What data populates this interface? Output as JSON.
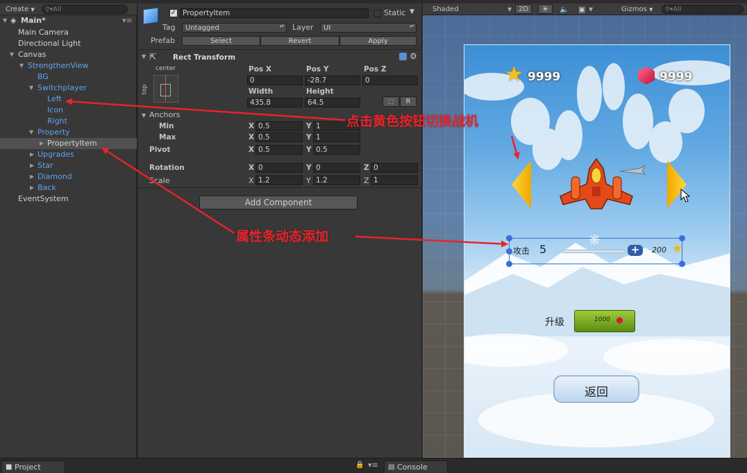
{
  "hierarchy": {
    "create_label": "Create",
    "search_placeholder": "All",
    "scene_name": "Main*",
    "items": [
      {
        "label": "Main Camera"
      },
      {
        "label": "Directional Light"
      },
      {
        "label": "Canvas"
      },
      {
        "label": "StrengthenView"
      },
      {
        "label": "BG"
      },
      {
        "label": "Switchplayer"
      },
      {
        "label": "Left"
      },
      {
        "label": "Icon"
      },
      {
        "label": "Right"
      },
      {
        "label": "Property"
      },
      {
        "label": "PropertyItem"
      },
      {
        "label": "Upgrades"
      },
      {
        "label": "Star"
      },
      {
        "label": "Diamond"
      },
      {
        "label": "Back"
      },
      {
        "label": "EventSystem"
      }
    ]
  },
  "inspector": {
    "object_name": "PropertyItem",
    "static_label": "Static",
    "tag_label": "Tag",
    "tag_value": "Untagged",
    "layer_label": "Layer",
    "layer_value": "UI",
    "prefab_label": "Prefab",
    "prefab_select": "Select",
    "prefab_revert": "Revert",
    "prefab_apply": "Apply",
    "rect_transform_title": "Rect Transform",
    "anchor_preset_h": "center",
    "anchor_preset_v": "top",
    "pos_x_label": "Pos X",
    "pos_y_label": "Pos Y",
    "pos_z_label": "Pos Z",
    "pos_x": "0",
    "pos_y": "-28.7",
    "pos_z": "0",
    "width_label": "Width",
    "height_label": "Height",
    "width": "435.8",
    "height": "64.5",
    "r_button": "R",
    "anchors_label": "Anchors",
    "min_label": "Min",
    "max_label": "Max",
    "pivot_label": "Pivot",
    "rotation_label": "Rotation",
    "scale_label": "Scale",
    "x_label": "X",
    "y_label": "Y",
    "z_label": "Z",
    "anchor_min_x": "0.5",
    "anchor_min_y": "1",
    "anchor_max_x": "0.5",
    "anchor_max_y": "1",
    "pivot_x": "0.5",
    "pivot_y": "0.5",
    "rot_x": "0",
    "rot_y": "0",
    "rot_z": "0",
    "scale_x": "1.2",
    "scale_y": "1.2",
    "scale_z": "1",
    "add_component": "Add Component"
  },
  "scene": {
    "shading_mode": "Shaded",
    "mode_2d": "2D",
    "gizmos_label": "Gizmos",
    "search_placeholder": "All",
    "game": {
      "star_count": "9999",
      "diamond_count": "9999",
      "attack_label": "攻击",
      "attack_value": "5",
      "plus_label": "+",
      "upgrade_cost": "200",
      "upgrade_label": "升级",
      "upgrade_button_cost": "1000",
      "back_label": "返回"
    }
  },
  "bottom": {
    "project_tab": "Project",
    "console_tab": "Console"
  },
  "annotations": {
    "switch_plane": "点击黄色按钮切换战机",
    "dynamic_add": "属性条动态添加"
  },
  "colors": {
    "annotation_red": "#e8232a",
    "hierarchy_blue": "#5fa4ec",
    "panel_bg": "#383838"
  }
}
